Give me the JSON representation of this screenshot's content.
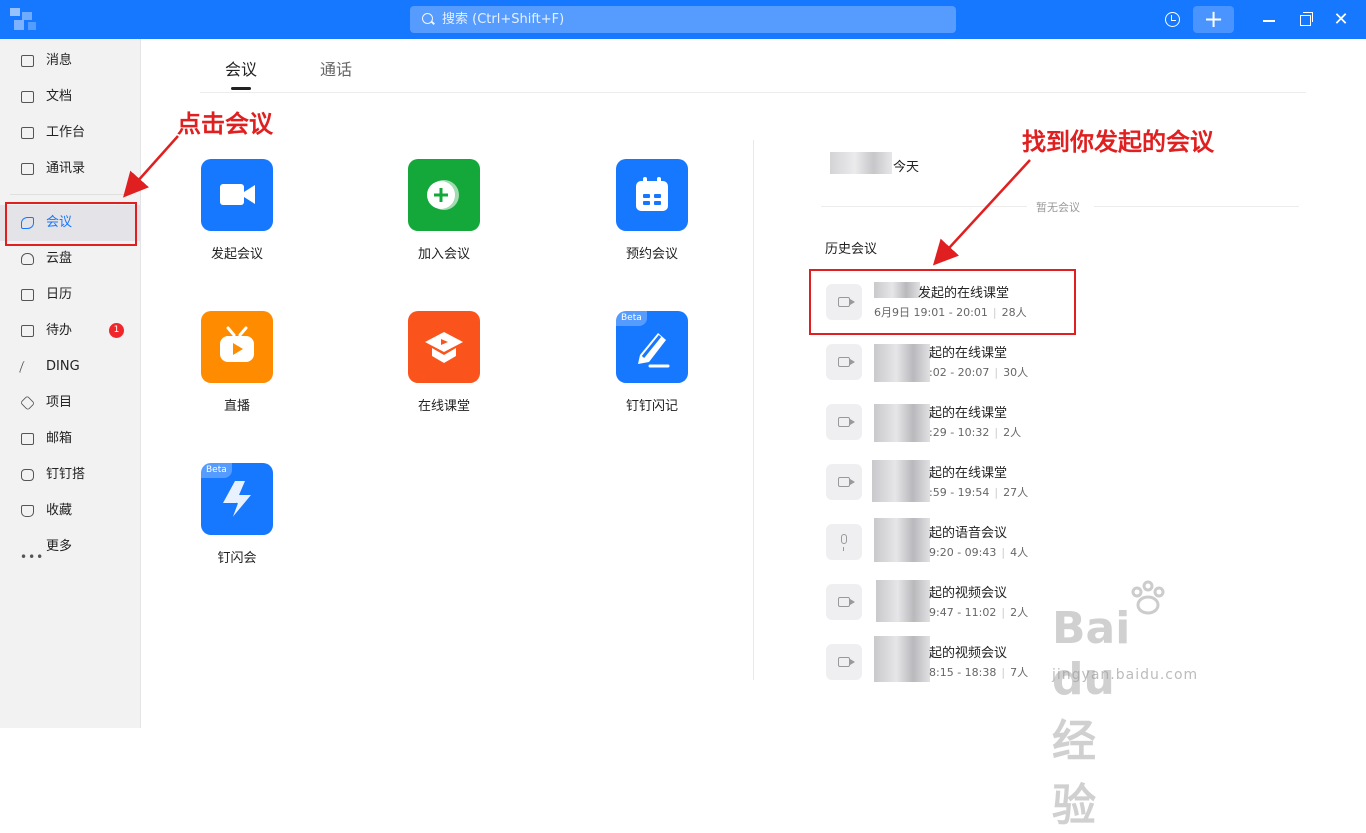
{
  "titlebar": {
    "search_placeholder": "搜索 (Ctrl+Shift+F)",
    "add_label": "+",
    "close_label": "✕"
  },
  "sidebar": {
    "items": [
      {
        "label": "消息"
      },
      {
        "label": "文档"
      },
      {
        "label": "工作台"
      },
      {
        "label": "通讯录"
      },
      {
        "label": "会议"
      },
      {
        "label": "云盘"
      },
      {
        "label": "日历"
      },
      {
        "label": "待办",
        "badge": "1"
      },
      {
        "label": "DING"
      },
      {
        "label": "项目"
      },
      {
        "label": "邮箱"
      },
      {
        "label": "钉钉搭"
      },
      {
        "label": "收藏"
      },
      {
        "label": "更多"
      }
    ]
  },
  "tabs": {
    "meeting": "会议",
    "call": "通话"
  },
  "tiles": [
    {
      "label": "发起会议",
      "color": "#1677ff"
    },
    {
      "label": "加入会议",
      "color": "#14a83b"
    },
    {
      "label": "预约会议",
      "color": "#1677ff"
    },
    {
      "label": "直播",
      "color": "#ff8c00"
    },
    {
      "label": "在线课堂",
      "color": "#fa541c"
    },
    {
      "label": "钉钉闪记",
      "color": "#1677ff",
      "badge": "Beta"
    },
    {
      "label": "钉闪会",
      "color": "#1677ff",
      "badge": "Beta"
    }
  ],
  "today": {
    "label": "今天",
    "empty": "暂无会议"
  },
  "history": {
    "title": "历史会议",
    "items": [
      {
        "title": "发起的在线课堂",
        "time": "6月9日 19:01 - 20:01",
        "people": "28人",
        "type": "video"
      },
      {
        "title": "起的在线课堂",
        "time": ":02 - 20:07",
        "people": "30人",
        "type": "video"
      },
      {
        "title": "起的在线课堂",
        "time": ":29 - 10:32",
        "people": "2人",
        "type": "video"
      },
      {
        "title": "起的在线课堂",
        "time": ":59 - 19:54",
        "people": "27人",
        "type": "video"
      },
      {
        "title": "起的语音会议",
        "time": "9:20 - 09:43",
        "people": "4人",
        "type": "voice"
      },
      {
        "title": "起的视频会议",
        "time": "9:47 - 11:02",
        "people": "2人",
        "type": "video"
      },
      {
        "title": "起的视频会议",
        "time": "8:15 - 18:38",
        "people": "7人",
        "type": "video"
      }
    ]
  },
  "annotations": {
    "click_meeting": "点击会议",
    "find_meeting": "找到你发起的会议"
  },
  "watermark": {
    "main": "Bai  du 经验",
    "sub": "jingyan.baidu.com"
  }
}
